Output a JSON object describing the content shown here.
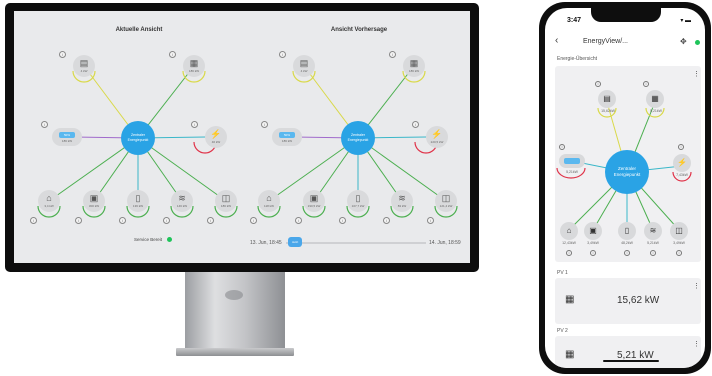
{
  "monitor": {
    "left_title": "Aktuelle Ansicht",
    "right_title": "Ansicht Vorhersage",
    "hub_label": "Zentraler Energiepunkt",
    "service_label": "Service Bereit",
    "timeline_start": "13. Jun, 18:45",
    "timeline_end": "14. Jun, 18:59",
    "timeline_thumb": "Jetzt",
    "battery_pct": "50%",
    "values_left": [
      "4 kW",
      "186 kW",
      "186 kW",
      "46 kW",
      "3,4 kW",
      "300 kW",
      "136 kW",
      "146 kW",
      "186 kW"
    ],
    "values_right": [
      "4 kW",
      "186 kW",
      "186 kW",
      "220,5 kW",
      "118 kW",
      "190,5 kW",
      "107,7 kW",
      "83 kW",
      "121,4 kW"
    ]
  },
  "phone": {
    "time": "3:47",
    "status_icons": "▾ ▬",
    "title": "EnergyView/...",
    "section_overview": "Energie-Übersicht",
    "hub_label": "Zentraler Energiepunkt",
    "top_values": [
      "15,62kW",
      "5,21kW"
    ],
    "side_values": [
      "5,21kW",
      "7,43kW"
    ],
    "bottom_values": [
      "12,43kW",
      "3,49kW",
      "48,2kW",
      "5,21kW",
      "3,49kW"
    ],
    "pv1_label": "PV 1",
    "pv1_value": "15,62 kW",
    "pv2_label": "PV 2",
    "pv2_value": "5,21 kW"
  },
  "colors": {
    "hub": "#2aa3e5",
    "battery": "#5ab8ef",
    "online": "#1ec45a",
    "flow_green": "#4caf50",
    "flow_yellow": "#d9d94a",
    "flow_teal": "#3ab7c9"
  }
}
